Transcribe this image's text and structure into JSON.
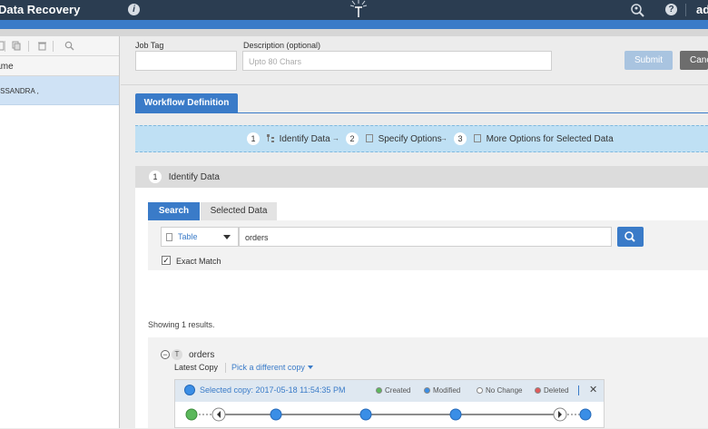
{
  "header": {
    "title": "Data Recovery",
    "user": "ad",
    "info_glyph": "i",
    "help_glyph": "?"
  },
  "left_panel": {
    "column_header": "Name",
    "rows": [
      {
        "label": "CASSANDRA ,"
      }
    ]
  },
  "form": {
    "job_tag_label": "Job Tag",
    "job_tag_value": "",
    "description_label": "Description (optional)",
    "description_placeholder": "Upto 80 Chars",
    "submit_label": "Submit",
    "cancel_label": "Cancel"
  },
  "workflow": {
    "tab_label": "Workflow Definition",
    "steps": [
      {
        "num": "1",
        "label": "Identify Data"
      },
      {
        "num": "2",
        "label": "Specify Options"
      },
      {
        "num": "3",
        "label": "More Options for Selected Data"
      }
    ],
    "arrow_glyph": "→"
  },
  "identify": {
    "num": "1",
    "title": "Identify Data",
    "tabs": {
      "search": "Search",
      "selected": "Selected Data"
    },
    "object_type": "Table",
    "query": "orders",
    "exact_match_label": "Exact Match",
    "exact_match_checked": "✓",
    "showing": "Showing 1 results."
  },
  "result": {
    "expand_glyph": "−",
    "type_badge": "T",
    "name": "orders",
    "latest_copy_label": "Latest Copy",
    "pick_label": "Pick a different copy",
    "selected_copy": "Selected copy: 2017-05-18 11:54:35 PM",
    "legend": [
      {
        "label": "Created",
        "color": "#5cb85c"
      },
      {
        "label": "Modified",
        "color": "#3a8ee6"
      },
      {
        "label": "No Change",
        "color": "#ffffff"
      },
      {
        "label": "Deleted",
        "color": "#e05a5a"
      }
    ],
    "close_glyph": "✕"
  },
  "colors": {
    "primary": "#3a7bc8",
    "topbar": "#2b3d51",
    "modified": "#3a8ee6",
    "created": "#5cb85c"
  }
}
